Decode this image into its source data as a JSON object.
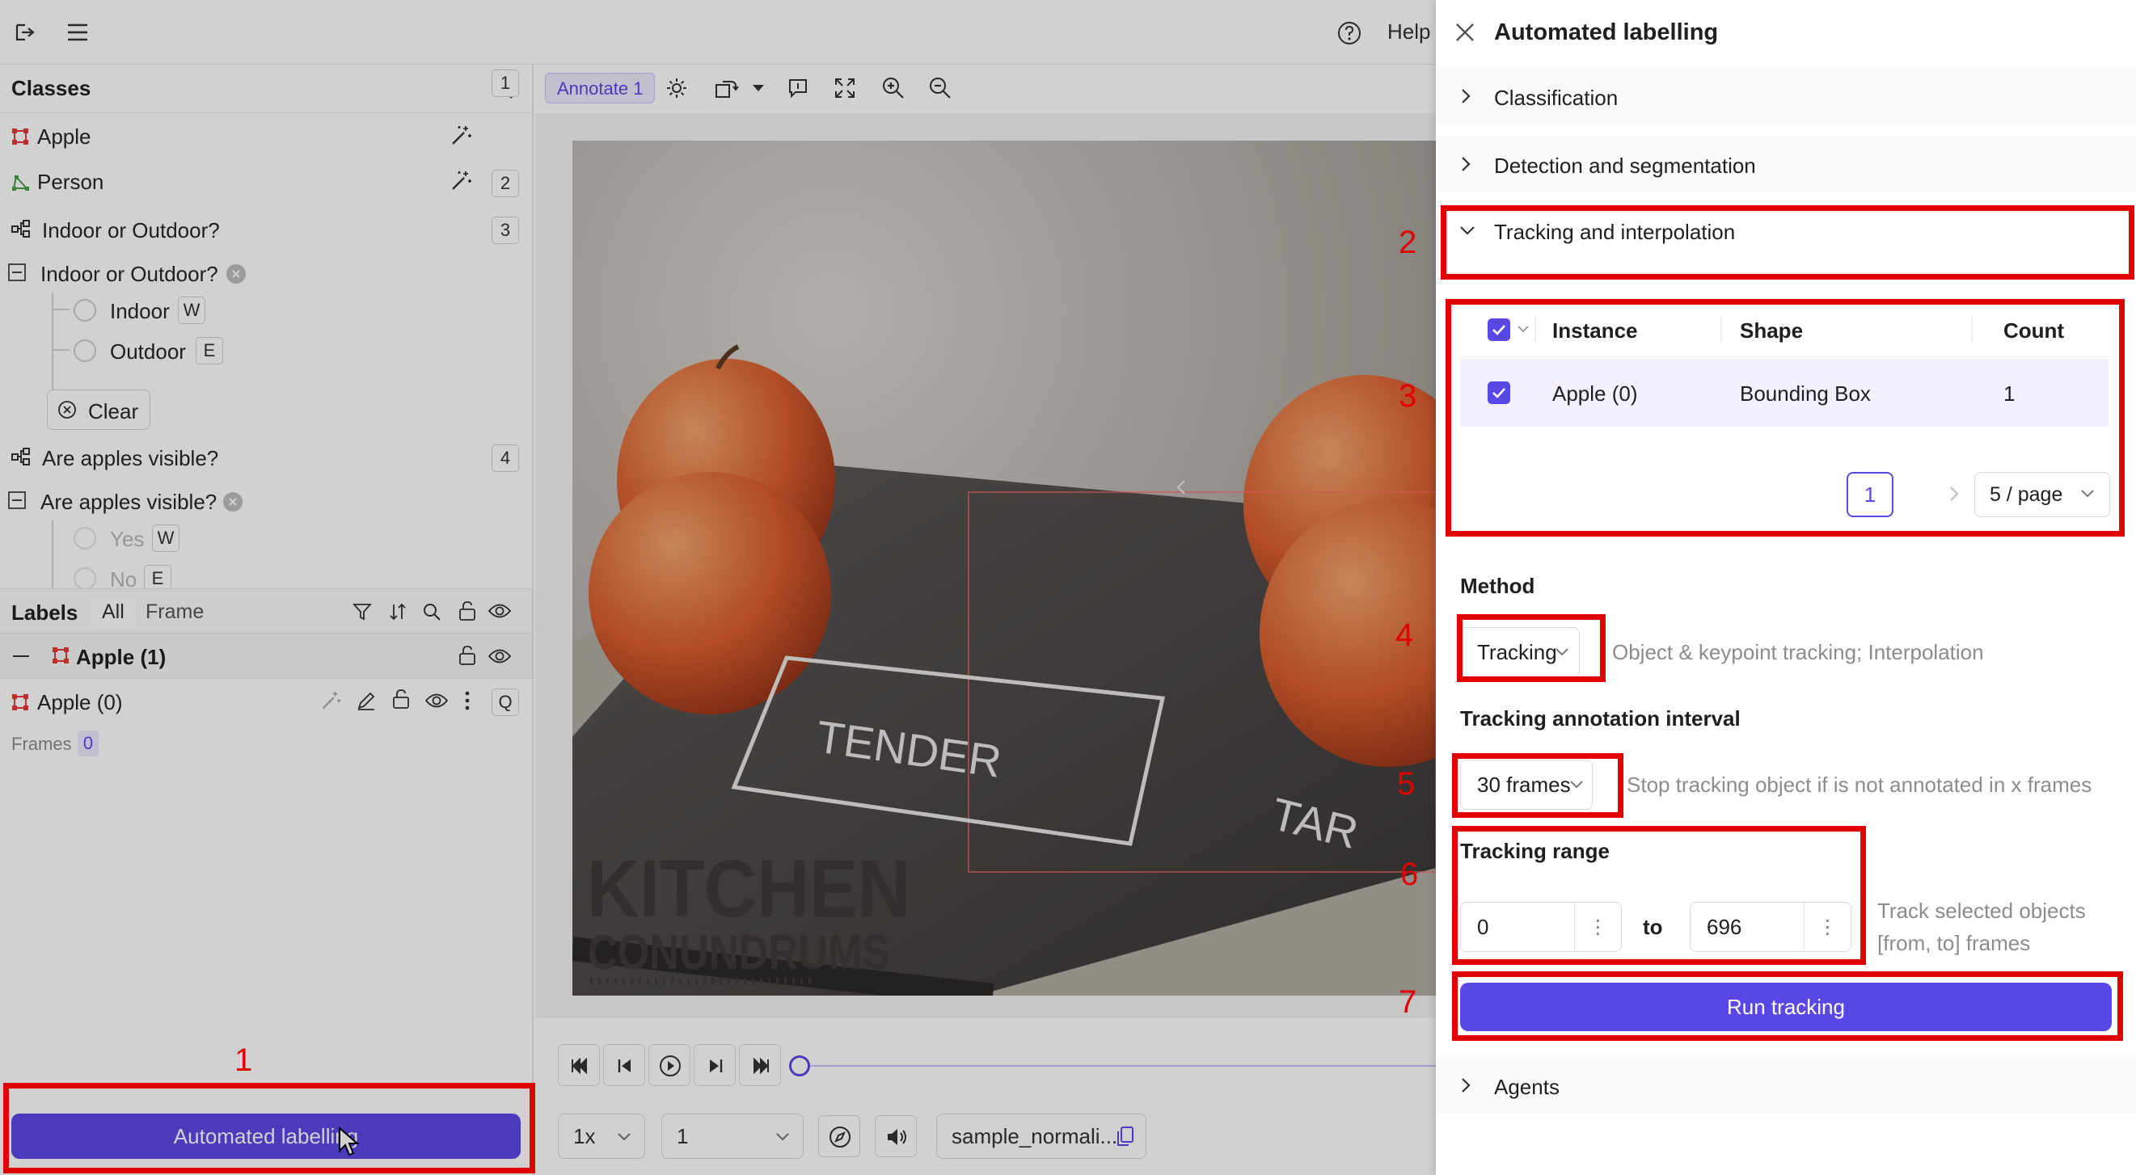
{
  "topbar": {
    "help_label": "Help"
  },
  "classes": {
    "title": "Classes",
    "items": [
      {
        "label": "Apple",
        "key": "1"
      },
      {
        "label": "Person",
        "key": "2"
      },
      {
        "label": "Indoor or Outdoor?",
        "key": "3"
      },
      {
        "label": "Indoor or Outdoor?"
      },
      {
        "label": "Indoor",
        "key": "W"
      },
      {
        "label": "Outdoor",
        "key": "E"
      },
      {
        "label": "Clear"
      },
      {
        "label": "Are apples visible?",
        "key": "4"
      },
      {
        "label": "Are apples visible?"
      },
      {
        "label": "Yes",
        "key": "W"
      },
      {
        "label": "No",
        "key": "E"
      }
    ]
  },
  "labels": {
    "title": "Labels",
    "tab_all": "All",
    "tab_frame": "Frame",
    "group": "Apple (1)",
    "instance": "Apple (0)",
    "instance_key": "Q",
    "frames_label": "Frames",
    "frames_value": "0"
  },
  "automated_button": "Automated labelling",
  "toolbar": {
    "annotate_tag": "Annotate 1"
  },
  "photo": {
    "logo_line1": "KITCHEN",
    "logo_line2": "CONUNDRUMS",
    "slate_text": "TENDER",
    "slate_text2": "TAR"
  },
  "player": {
    "speed": "1x",
    "frame": "1",
    "filename": "sample_normali..."
  },
  "panel": {
    "title": "Automated labelling",
    "sections": {
      "classification": "Classification",
      "detection": "Detection and segmentation",
      "tracking": "Tracking and interpolation",
      "agents": "Agents"
    },
    "table": {
      "headers": [
        "Instance",
        "Shape",
        "Count"
      ],
      "rows": [
        {
          "instance": "Apple (0)",
          "shape": "Bounding Box",
          "count": "1"
        }
      ],
      "page": "1",
      "page_size": "5 / page"
    },
    "method": {
      "label": "Method",
      "value": "Tracking",
      "hint": "Object & keypoint tracking; Interpolation"
    },
    "interval": {
      "label": "Tracking annotation interval",
      "value": "30 frames",
      "hint": "Stop tracking object if is not annotated in x frames"
    },
    "range": {
      "label": "Tracking range",
      "from": "0",
      "to_label": "to",
      "to": "696",
      "hint_line1": "Track selected objects",
      "hint_line2": "[from, to] frames"
    },
    "run_button": "Run tracking"
  },
  "annotations": [
    "1",
    "2",
    "3",
    "4",
    "5",
    "6",
    "7"
  ],
  "colors": {
    "accent": "#5a48e6",
    "annotation": "#e00000",
    "apple_class": "#e53935",
    "person_class": "#43a047"
  }
}
